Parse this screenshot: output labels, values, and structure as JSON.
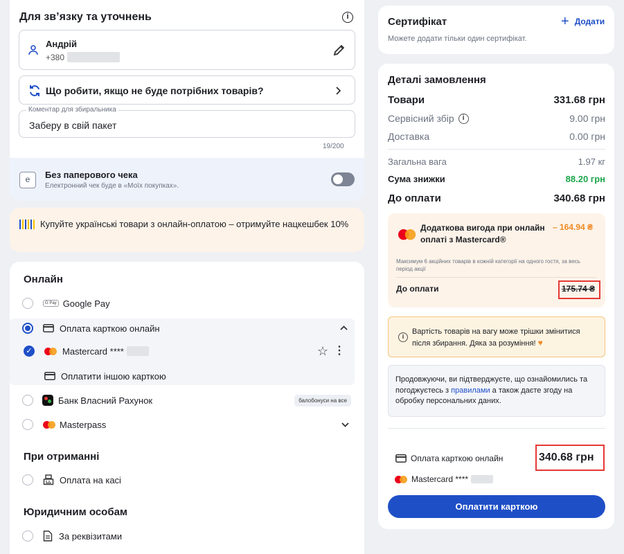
{
  "contact": {
    "title": "Для зв’язку та уточнень",
    "name": "Андрій",
    "phone_prefix": "+380",
    "no_items_label": "Що робити, якщо не буде потрібних товарів?",
    "comment_label": "Коментар для збиральника",
    "comment_value": "Заберу в свій пакет",
    "comment_counter": "19/200"
  },
  "receipt": {
    "title": "Без паперового чека",
    "subtitle": "Електронний чек буде в «Моїх покупках»."
  },
  "promo": {
    "text": "Купуйте українські товари з онлайн-оплатою – отримуйте нацкешбек 10%"
  },
  "payment": {
    "online_title": "Онлайн",
    "google_pay": "Google Pay",
    "gpay_badge": "G Pay",
    "card_online": "Оплата карткою онлайн",
    "mastercard_label": "Mastercard ****",
    "other_card": "Оплатити іншою карткою",
    "bank": "Банк Власний Рахунок",
    "bank_badge": "балобонуси на все",
    "masterpass": "Masterpass",
    "on_receipt_title": "При отриманні",
    "pay_at_checkout": "Оплата на касі",
    "legal_title": "Юридичним особам",
    "by_requisites": "За реквізитами"
  },
  "certificate": {
    "title": "Сертифікат",
    "add_label": "Додати",
    "subtitle": "Можете додати тільки один сертифікат."
  },
  "order": {
    "title": "Деталі замовлення",
    "goods_label": "Товари",
    "goods_value": "331.68 грн",
    "service_label": "Сервісний збір",
    "service_value": "9.00 грн",
    "delivery_label": "Доставка",
    "delivery_value": "0.00 грн",
    "weight_label": "Загальна вага",
    "weight_value": "1.97 кг",
    "discount_label": "Сума знижки",
    "discount_value": "88.20 грн",
    "total_label": "До оплати",
    "total_value": "340.68 грн"
  },
  "mc_offer": {
    "title": "Додаткова вигода при онлайн оплаті з Mastercard®",
    "amount": "– 164.94 ₴",
    "note": "Максимум 6 акційних товарів в кожній категорії на одного гостя, за весь період акції",
    "pay_label": "До оплати",
    "pay_value": "175.74 ₴"
  },
  "weight_notice": {
    "text": "Вартість товарів на вагу може трішки змінитися після збирання. Дяка за розуміння!"
  },
  "consent": {
    "before": "Продовжуючи, ви підтверджуєте, що ознайомились та погоджуєтесь з",
    "link": "правилами",
    "after": "а також даєте згоду на обробку персональних даних."
  },
  "summary": {
    "method": "Оплата карткою онлайн",
    "amount": "340.68 грн",
    "card": "Mastercard ****",
    "pay_button": "Оплатити карткою"
  },
  "colors": {
    "accent": "#1f4fc7",
    "discount_green": "#1aa64a",
    "offer_orange": "#f08a24",
    "highlight_red": "#e53935"
  }
}
